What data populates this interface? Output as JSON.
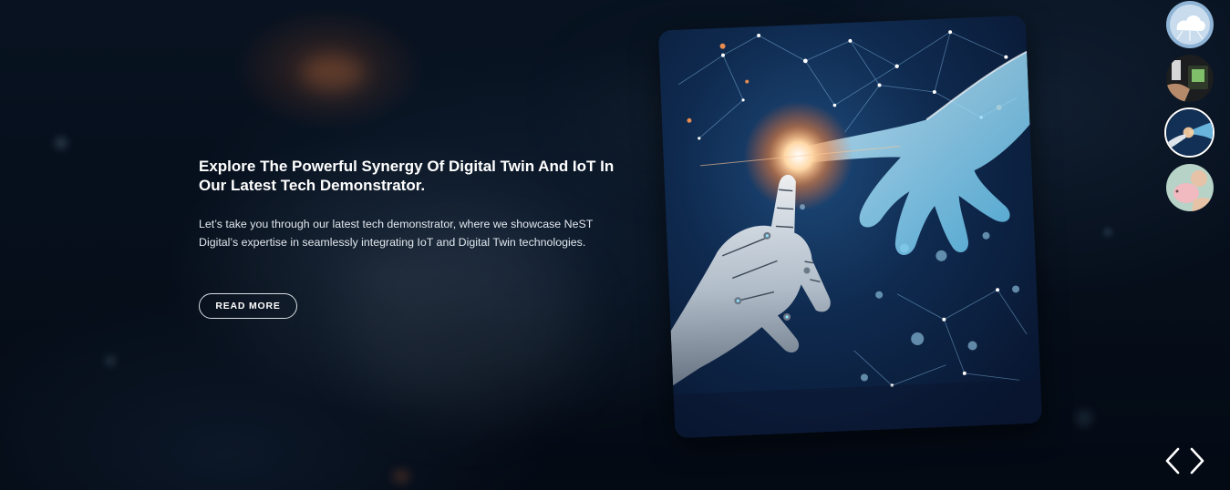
{
  "slide": {
    "title": "Explore The Powerful Synergy Of Digital Twin And IoT In Our Latest Tech Demonstrator.",
    "description": "Let’s take you through our latest tech demonstrator, where we showcase NeST Digital’s expertise in seamlessly integrating IoT and Digital Twin technologies.",
    "cta_label": "READ MORE"
  },
  "thumbnails": {
    "count": 4,
    "active_index": 2,
    "items": [
      {
        "icon": "cloud-network-thumbnail"
      },
      {
        "icon": "device-hand-thumbnail"
      },
      {
        "icon": "robot-hand-thumbnail"
      },
      {
        "icon": "piggy-bank-thumbnail"
      }
    ]
  },
  "navigation": {
    "prev_icon": "chevron-left-icon",
    "next_icon": "chevron-right-icon"
  },
  "colors": {
    "background": "#07101c",
    "text": "#ffffff",
    "accent_glow": "#ff8a3c",
    "digital_blue": "#7fd6ff"
  }
}
